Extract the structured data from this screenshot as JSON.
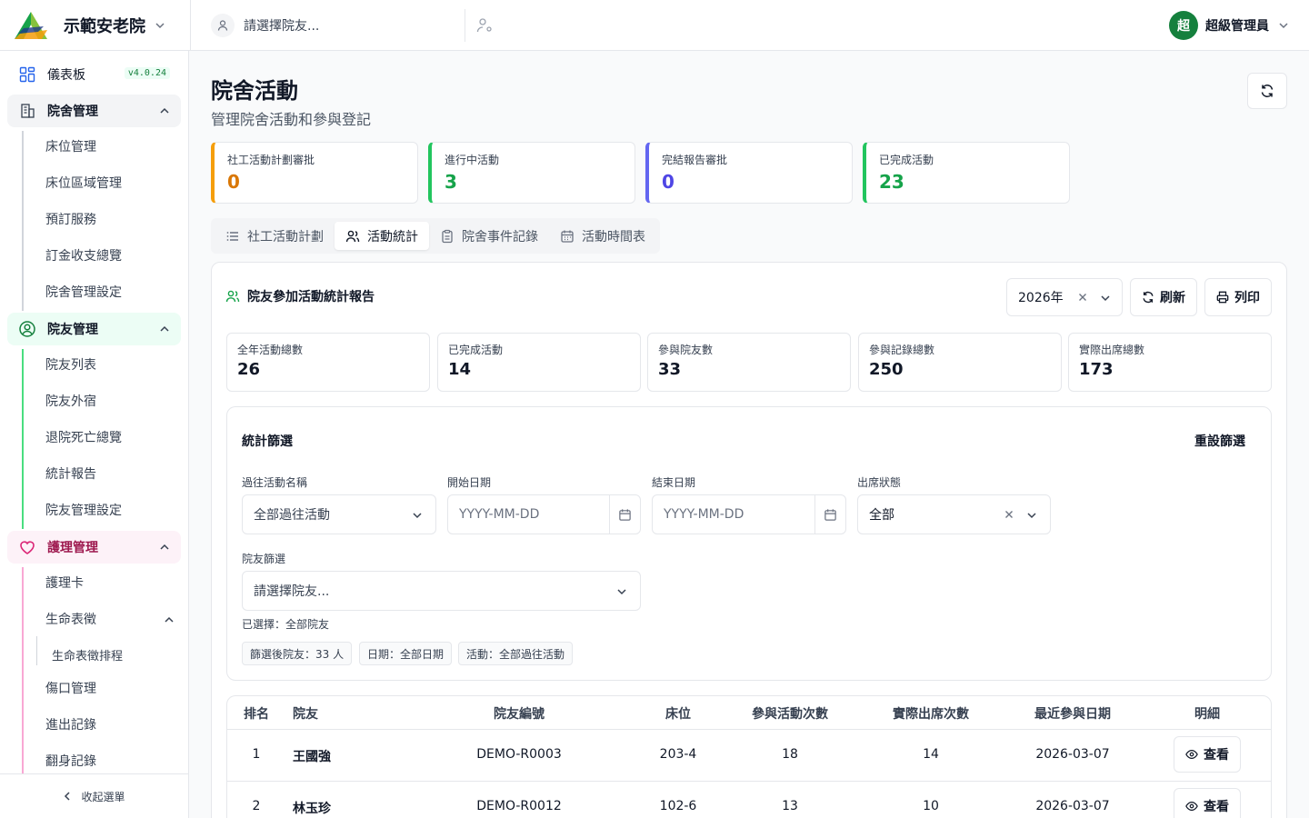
{
  "header": {
    "facility_name": "示範安老院",
    "resident_placeholder": "請選擇院友...",
    "user_avatar": "超",
    "user_name": "超級管理員"
  },
  "sidebar": {
    "dashboard": "儀表板",
    "version": "v4.0.24",
    "groups": [
      {
        "label": "院舍管理",
        "items": [
          "床位管理",
          "床位區域管理",
          "預訂服務",
          "訂金收支總覽",
          "院舍管理設定"
        ]
      },
      {
        "label": "院友管理",
        "items": [
          "院友列表",
          "院友外宿",
          "退院死亡總覽",
          "統計報告",
          "院友管理設定"
        ]
      },
      {
        "label": "護理管理",
        "items": [
          "護理卡",
          "生命表徵",
          "傷口管理",
          "進出記錄",
          "翻身記錄"
        ],
        "sub": "生命表徵排程"
      }
    ],
    "collapse": "收起選單"
  },
  "page": {
    "title": "院舍活動",
    "subtitle": "管理院舍活動和參與登記"
  },
  "stats": [
    {
      "label": "社工活動計劃審批",
      "value": "0",
      "color": "#d97706"
    },
    {
      "label": "進行中活動",
      "value": "3",
      "color": "#16a34a"
    },
    {
      "label": "完結報告審批",
      "value": "0",
      "color": "#4f46e5"
    },
    {
      "label": "已完成活動",
      "value": "23",
      "color": "#16a34a"
    }
  ],
  "tabs": [
    "社工活動計劃",
    "活動統計",
    "院舍事件記錄",
    "活動時間表"
  ],
  "report": {
    "title": "院友參加活動統計報告",
    "year": "2026年",
    "refresh": "刷新",
    "print": "列印",
    "cards": [
      {
        "label": "全年活動總數",
        "value": "26"
      },
      {
        "label": "已完成活動",
        "value": "14"
      },
      {
        "label": "參與院友數",
        "value": "33"
      },
      {
        "label": "參與記錄總數",
        "value": "250"
      },
      {
        "label": "實際出席總數",
        "value": "173"
      }
    ]
  },
  "filter": {
    "title": "統計篩選",
    "reset": "重設篩選",
    "activity_label": "過往活動名稱",
    "activity_value": "全部過往活動",
    "start_label": "開始日期",
    "start_placeholder": "YYYY-MM-DD",
    "end_label": "結束日期",
    "end_placeholder": "YYYY-MM-DD",
    "status_label": "出席狀態",
    "status_value": "全部",
    "resident_label": "院友篩選",
    "resident_placeholder": "請選擇院友...",
    "selected": "已選擇：全部院友",
    "chips": [
      "篩選後院友：33 人",
      "日期：全部日期",
      "活動：全部過往活動"
    ]
  },
  "table": {
    "headers": [
      "排名",
      "院友",
      "院友編號",
      "床位",
      "參與活動次數",
      "實際出席次數",
      "最近參與日期",
      "明細"
    ],
    "view_label": "查看",
    "rows": [
      {
        "rank": "1",
        "name": "王國強",
        "id": "DEMO-R0003",
        "bed": "203-4",
        "joined": "18",
        "attended": "14",
        "last": "2026-03-07"
      },
      {
        "rank": "2",
        "name": "林玉珍",
        "id": "DEMO-R0012",
        "bed": "102-6",
        "joined": "13",
        "attended": "10",
        "last": "2026-03-07"
      }
    ]
  }
}
